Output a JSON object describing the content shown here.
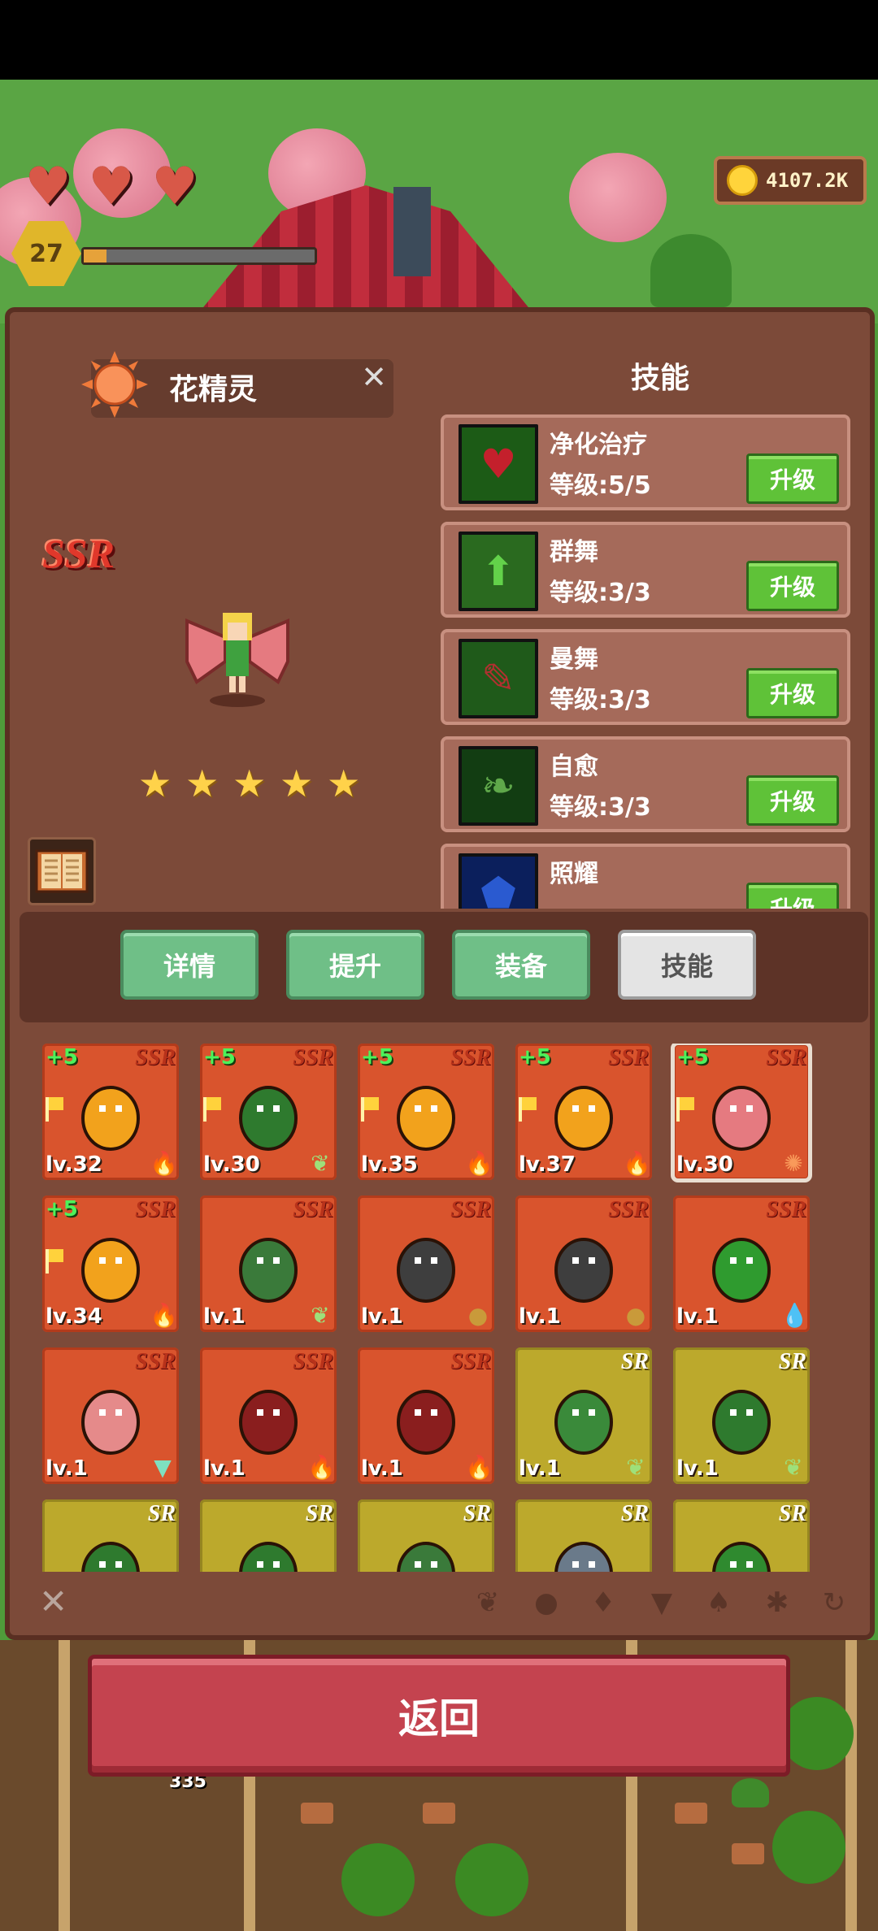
{
  "hud": {
    "hearts": 3,
    "player_level": "27",
    "xp_fraction": 0.1,
    "coins": "4107.2K"
  },
  "hero": {
    "name": "花精灵",
    "rarity": "SSR",
    "stars": 5,
    "element_icon": "sun-icon"
  },
  "skills_panel": {
    "title": "技能",
    "upgrade_label": "升级",
    "skills": [
      {
        "name": "净化治疗",
        "level": "等级:5/5",
        "icon": "heart-icon",
        "color": "#1c5b16"
      },
      {
        "name": "群舞",
        "level": "等级:3/3",
        "icon": "arrow-up-icon",
        "color": "#2a6a1f"
      },
      {
        "name": "曼舞",
        "level": "等级:3/3",
        "icon": "boot-icon",
        "color": "#1f5a1a"
      },
      {
        "name": "自愈",
        "level": "等级:3/3",
        "icon": "leaf-icon",
        "color": "#123d12"
      },
      {
        "name": "照耀",
        "level": "",
        "icon": "shield-icon",
        "color": "#0b1f5c"
      }
    ]
  },
  "tabs": [
    {
      "label": "详情",
      "active": false
    },
    {
      "label": "提升",
      "active": false
    },
    {
      "label": "装备",
      "active": false
    },
    {
      "label": "技能",
      "active": true
    }
  ],
  "hero_cards": [
    {
      "rarity": "SSR",
      "plus": "+5",
      "level": "lv.32",
      "flag": true,
      "element": "fire",
      "monster": "flame"
    },
    {
      "rarity": "SSR",
      "plus": "+5",
      "level": "lv.30",
      "flag": true,
      "element": "leaf",
      "monster": "treant"
    },
    {
      "rarity": "SSR",
      "plus": "+5",
      "level": "lv.35",
      "flag": true,
      "element": "fire",
      "monster": "flame"
    },
    {
      "rarity": "SSR",
      "plus": "+5",
      "level": "lv.37",
      "flag": true,
      "element": "fire",
      "monster": "flame"
    },
    {
      "rarity": "SSR",
      "plus": "+5",
      "level": "lv.30",
      "flag": true,
      "element": "sun",
      "monster": "fairy",
      "selected": true
    },
    {
      "rarity": "SSR",
      "plus": "+5",
      "level": "lv.34",
      "flag": true,
      "element": "fire",
      "monster": "flame"
    },
    {
      "rarity": "SSR",
      "plus": "",
      "level": "lv.1",
      "flag": false,
      "element": "leaf",
      "monster": "orc-knight"
    },
    {
      "rarity": "SSR",
      "plus": "",
      "level": "lv.1",
      "flag": false,
      "element": "earth",
      "monster": "golem"
    },
    {
      "rarity": "SSR",
      "plus": "",
      "level": "lv.1",
      "flag": false,
      "element": "earth",
      "monster": "golem"
    },
    {
      "rarity": "SSR",
      "plus": "",
      "level": "lv.1",
      "flag": false,
      "element": "water",
      "monster": "slime"
    },
    {
      "rarity": "SSR",
      "plus": "",
      "level": "lv.1",
      "flag": false,
      "element": "wind",
      "monster": "girl"
    },
    {
      "rarity": "SSR",
      "plus": "",
      "level": "lv.1",
      "flag": false,
      "element": "fire",
      "monster": "demon"
    },
    {
      "rarity": "SSR",
      "plus": "",
      "level": "lv.1",
      "flag": false,
      "element": "fire",
      "monster": "demon"
    },
    {
      "rarity": "SR",
      "plus": "",
      "level": "lv.1",
      "flag": false,
      "element": "leaf",
      "monster": "orc-axe"
    },
    {
      "rarity": "SR",
      "plus": "",
      "level": "lv.1",
      "flag": false,
      "element": "leaf",
      "monster": "treant"
    },
    {
      "rarity": "SR",
      "plus": "",
      "level": "",
      "flag": false,
      "element": "",
      "monster": "treant"
    },
    {
      "rarity": "SR",
      "plus": "",
      "level": "",
      "flag": false,
      "element": "",
      "monster": "treant"
    },
    {
      "rarity": "SR",
      "plus": "",
      "level": "",
      "flag": false,
      "element": "",
      "monster": "orc-knight"
    },
    {
      "rarity": "SR",
      "plus": "",
      "level": "",
      "flag": false,
      "element": "",
      "monster": "rock"
    },
    {
      "rarity": "SR",
      "plus": "",
      "level": "",
      "flag": false,
      "element": "",
      "monster": "bush"
    }
  ],
  "filter_bar": {
    "clear_icon": "close-icon",
    "filters": [
      "fire-filter-icon",
      "earth-filter-icon",
      "water-filter-icon",
      "wind-filter-icon",
      "flame-filter-icon",
      "star-filter-icon",
      "cycle-filter-icon"
    ]
  },
  "back_button": {
    "label": "返回"
  },
  "farm": {
    "counter": "335"
  }
}
